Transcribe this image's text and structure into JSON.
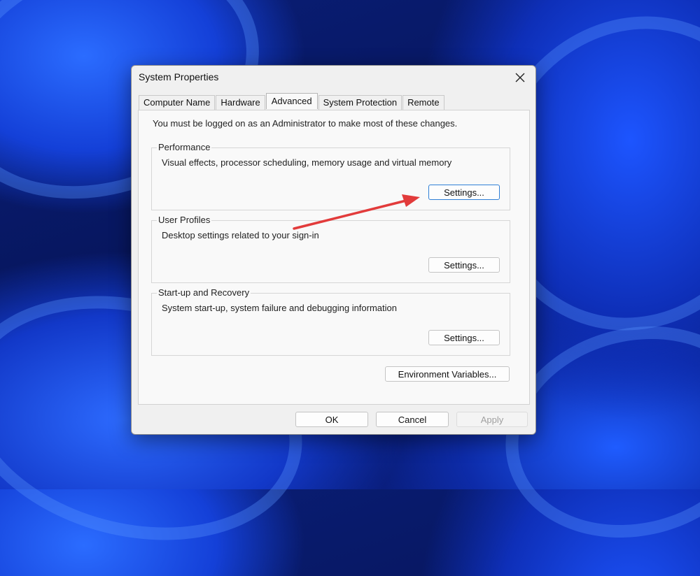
{
  "dialog": {
    "title": "System Properties",
    "close_icon": "close-icon",
    "tabs": [
      {
        "label": "Computer Name",
        "active": false
      },
      {
        "label": "Hardware",
        "active": false
      },
      {
        "label": "Advanced",
        "active": true
      },
      {
        "label": "System Protection",
        "active": false
      },
      {
        "label": "Remote",
        "active": false
      }
    ],
    "admin_note": "You must be logged on as an Administrator to make most of these changes.",
    "groups": {
      "performance": {
        "title": "Performance",
        "description": "Visual effects, processor scheduling, memory usage and virtual memory",
        "button": "Settings..."
      },
      "user_profiles": {
        "title": "User Profiles",
        "description": "Desktop settings related to your sign-in",
        "button": "Settings..."
      },
      "startup_recovery": {
        "title": "Start-up and Recovery",
        "description": "System start-up, system failure and debugging information",
        "button": "Settings..."
      }
    },
    "environment_button": "Environment Variables...",
    "footer": {
      "ok": "OK",
      "cancel": "Cancel",
      "apply": "Apply",
      "apply_enabled": false
    }
  },
  "annotation": {
    "type": "arrow",
    "color": "#e23b3b",
    "points_to": "performance-settings-button"
  }
}
